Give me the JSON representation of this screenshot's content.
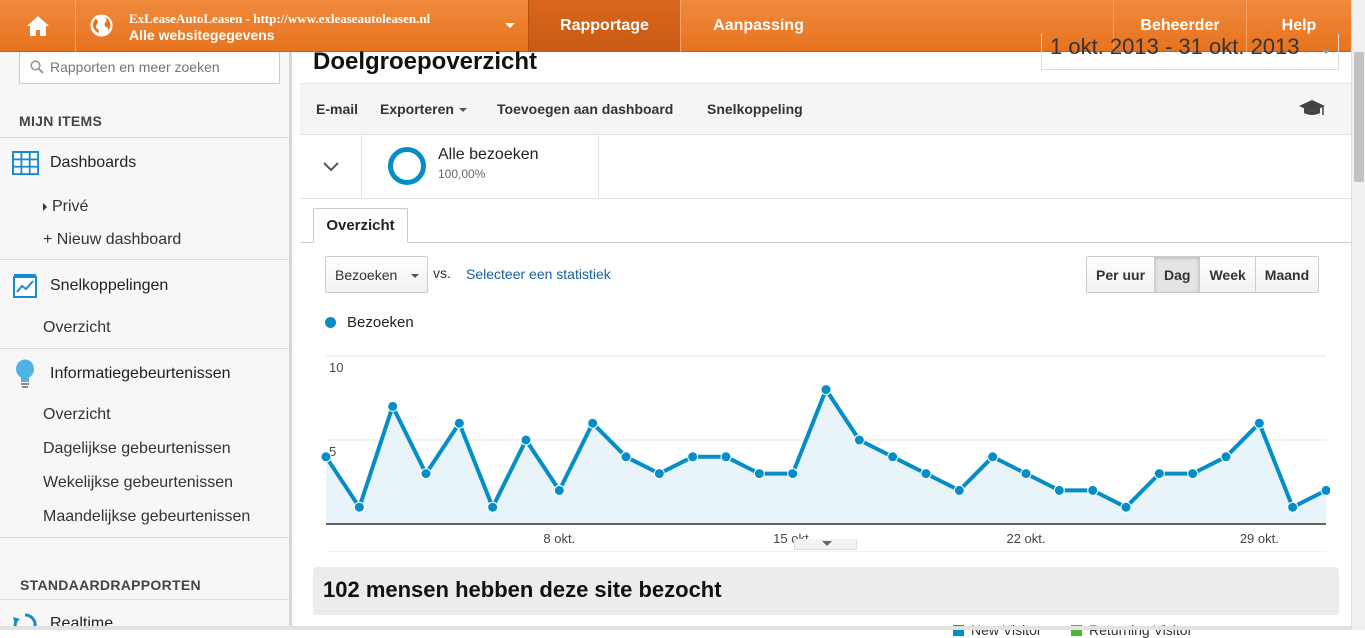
{
  "topbar": {
    "account_line1": "ExLeaseAutoLeasen - http://www.exleaseautoleasen.nl",
    "account_line2": "Alle websitegegevens",
    "tabs": [
      {
        "label": "Rapportage",
        "active": true
      },
      {
        "label": "Aanpassing",
        "active": false
      }
    ],
    "admin_label": "Beheerder",
    "help_label": "Help",
    "color": "#ec7f2f"
  },
  "sidebar": {
    "search_placeholder": "Rapporten en meer zoeken",
    "my_items_heading": "MIJN ITEMS",
    "dashboards_label": "Dashboards",
    "prive_label": "Privé",
    "new_dashboard_label": "+ Nieuw dashboard",
    "shortcuts_label": "Snelkoppelingen",
    "shortcuts_overview": "Overzicht",
    "intelligence_label": "Informatiegebeurtenissen",
    "intelligence_items": [
      "Overzicht",
      "Dagelijkse gebeurtenissen",
      "Wekelijkse gebeurtenissen",
      "Maandelijkse gebeurtenissen"
    ],
    "standard_heading": "STANDAARDRAPPORTEN",
    "realtime_label": "Realtime"
  },
  "main": {
    "title": "Doelgroepoverzicht",
    "date_range": "1 okt. 2013 - 31 okt. 2013",
    "actions": {
      "email": "E-mail",
      "export": "Exporteren",
      "add_dashboard": "Toevoegen aan dashboard",
      "shortcut": "Snelkoppeling"
    },
    "segment": {
      "name": "Alle bezoeken",
      "percent": "100,00%"
    },
    "tab_label": "Overzicht",
    "metric_select": "Bezoeken",
    "vs_label": "vs.",
    "select_stat": "Selecteer een statistiek",
    "granularity": [
      {
        "label": "Per uur",
        "active": false
      },
      {
        "label": "Dag",
        "active": true
      },
      {
        "label": "Week",
        "active": false
      },
      {
        "label": "Maand",
        "active": false
      }
    ],
    "summary": "102 mensen hebben deze site bezocht",
    "pie_legend": [
      {
        "label": "New Visitor",
        "color": "#058dc7"
      },
      {
        "label": "Returning Visitor",
        "color": "#50b432"
      }
    ]
  },
  "chart_data": {
    "type": "area",
    "series": [
      {
        "name": "Bezoeken",
        "color": "#058dc7",
        "values": [
          4,
          1,
          7,
          3,
          6,
          1,
          5,
          2,
          6,
          4,
          3,
          4,
          4,
          3,
          3,
          8,
          5,
          4,
          3,
          2,
          4,
          3,
          2,
          2,
          1,
          3,
          3,
          4,
          6,
          1,
          2
        ]
      }
    ],
    "x": [
      "1 okt.",
      "2 okt.",
      "3 okt.",
      "4 okt.",
      "5 okt.",
      "6 okt.",
      "7 okt.",
      "8 okt.",
      "9 okt.",
      "10 okt.",
      "11 okt.",
      "12 okt.",
      "13 okt.",
      "14 okt.",
      "15 okt.",
      "16 okt.",
      "17 okt.",
      "18 okt.",
      "19 okt.",
      "20 okt.",
      "21 okt.",
      "22 okt.",
      "23 okt.",
      "24 okt.",
      "25 okt.",
      "26 okt.",
      "27 okt.",
      "28 okt.",
      "29 okt.",
      "30 okt.",
      "31 okt."
    ],
    "x_tick_labels": [
      {
        "index": 7,
        "label": "8 okt."
      },
      {
        "index": 14,
        "label": "15 okt."
      },
      {
        "index": 21,
        "label": "22 okt."
      },
      {
        "index": 28,
        "label": "29 okt."
      }
    ],
    "y_ticks": [
      {
        "value": 10,
        "label": "10"
      },
      {
        "value": 5,
        "label": "5"
      }
    ],
    "ylim": [
      0,
      10
    ],
    "grid": true
  }
}
